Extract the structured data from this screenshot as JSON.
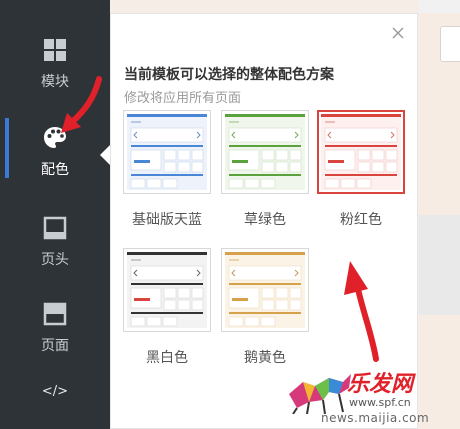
{
  "sidebar": {
    "items": [
      {
        "label": "模块",
        "icon": "modules-grid-icon"
      },
      {
        "label": "配色",
        "icon": "palette-icon",
        "active": true
      },
      {
        "label": "页头",
        "icon": "page-header-icon"
      },
      {
        "label": "页面",
        "icon": "page-icon"
      },
      {
        "label": "</>",
        "icon": "code-icon"
      }
    ]
  },
  "panel": {
    "title": "当前模板可以选择的整体配色方案",
    "subtitle": "修改将应用所有页面",
    "themes": [
      {
        "name": "基础版天蓝",
        "color": "#4a86d6",
        "selected": false
      },
      {
        "name": "草绿色",
        "color": "#5aa33c",
        "selected": false
      },
      {
        "name": "粉红色",
        "color": "#d9443f",
        "selected": true
      },
      {
        "name": "黑白色",
        "color": "#333333",
        "selected": false
      },
      {
        "name": "鹅黄色",
        "color": "#d7a04a",
        "selected": false
      }
    ]
  },
  "watermark": {
    "brand": "乐发网",
    "url1": "www.spf.cn",
    "url2": "news.maijia.com"
  },
  "colors": {
    "sidebar_bg": "#2e3338",
    "active_indicator": "#3b7bd3",
    "annotation_arrow": "#e0212a"
  }
}
